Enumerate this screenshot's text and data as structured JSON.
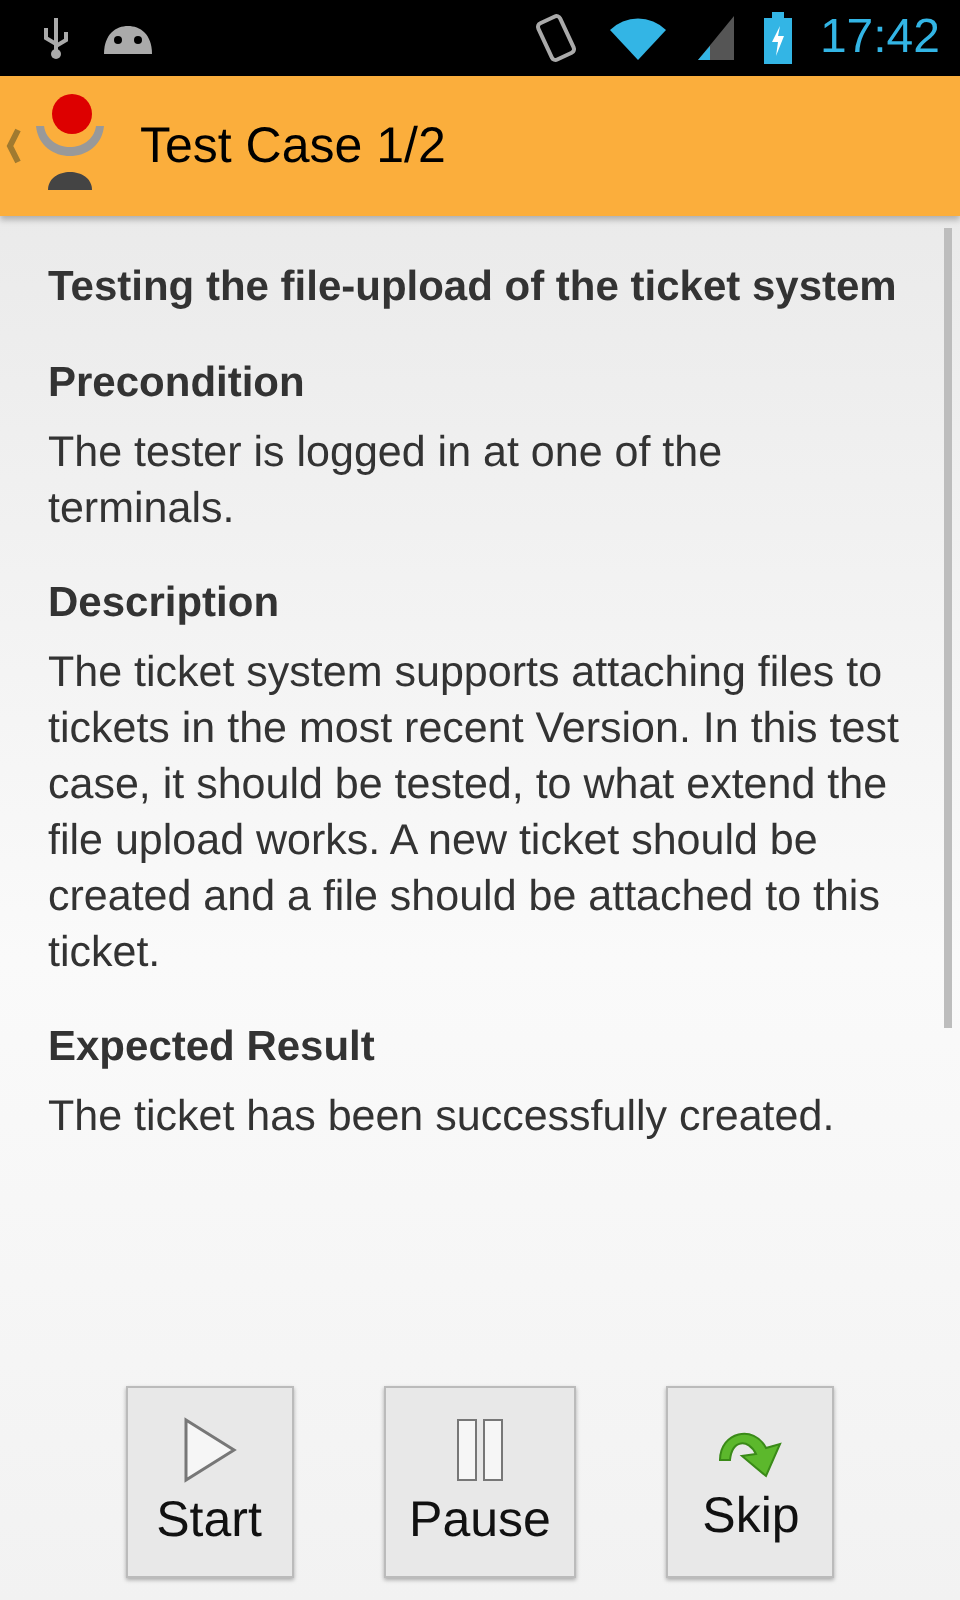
{
  "status_bar": {
    "time": "17:42"
  },
  "action_bar": {
    "title": "Test Case 1/2"
  },
  "test_case": {
    "title": "Testing the file-upload of the ticket system",
    "sections": [
      {
        "heading": "Precondition",
        "text": "The tester is logged in at one of the terminals."
      },
      {
        "heading": "Description",
        "text": "The ticket system supports attaching files to tickets in the most recent Version. In this test case, it should be tested, to what extend the file upload works. A new ticket should be created and a file should be attached to this ticket."
      },
      {
        "heading": "Expected Result",
        "text": "The ticket has been successfully created."
      }
    ]
  },
  "buttons": [
    {
      "kind": "start",
      "label": "Start"
    },
    {
      "kind": "pause",
      "label": "Pause"
    },
    {
      "kind": "skip",
      "label": "Skip"
    }
  ]
}
